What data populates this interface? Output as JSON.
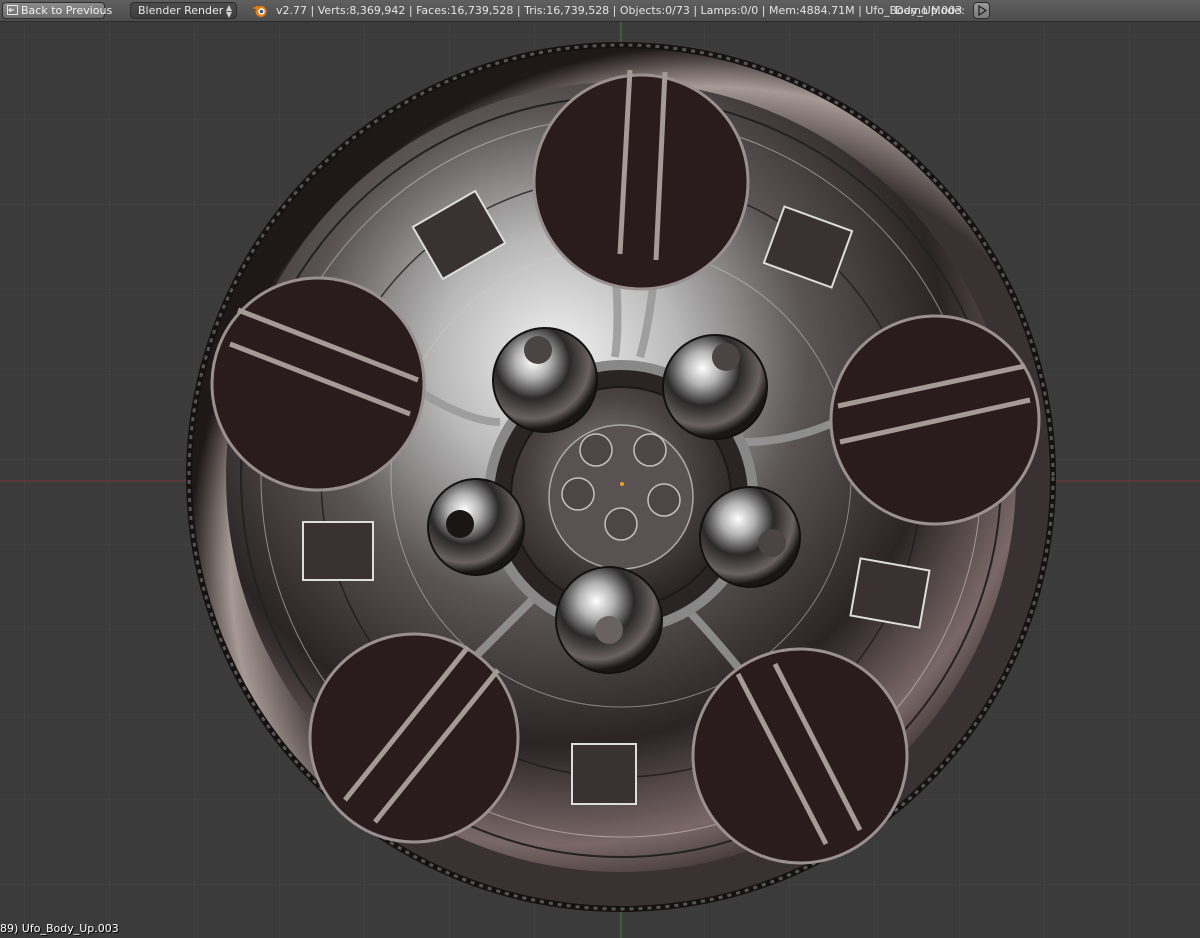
{
  "header": {
    "back_button_label": "Back to Previous",
    "render_engine": "Blender Render",
    "stats": "v2.77 | Verts:8,369,942 | Faces:16,739,528 | Tris:16,739,528 | Objects:0/73 | Lamps:0/0 | Mem:4884.71M | Ufo_Body_Up.003",
    "demo_mode_label": "Demo Mode:"
  },
  "viewport": {
    "object_label": "89) Ufo_Body_Up.003",
    "icons": [
      "back-icon",
      "blender-logo-icon",
      "play-icon"
    ]
  },
  "colors": {
    "viewport_bg": "#3b3b3b",
    "axis_x": "#8a3030",
    "axis_y": "#3d7a3d",
    "panel_fill": "#2a1c1c"
  }
}
